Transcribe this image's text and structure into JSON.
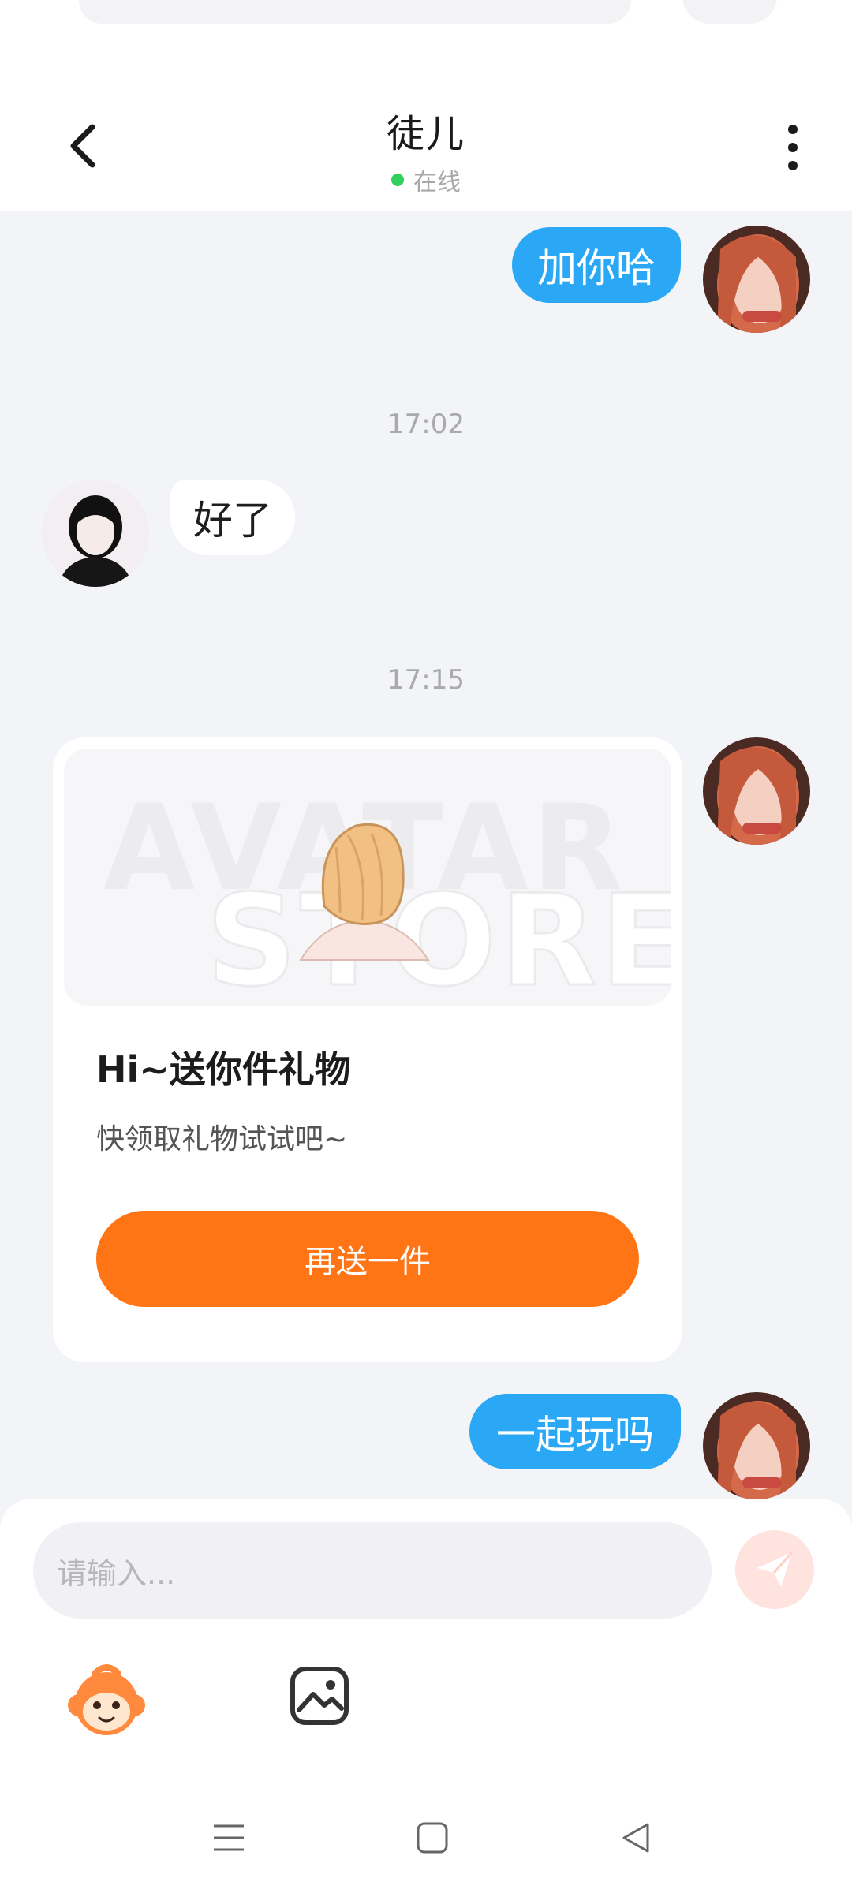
{
  "header": {
    "title": "徒儿",
    "status": "在线",
    "status_color": "#2fd05c"
  },
  "messages": [
    {
      "direction": "out",
      "text": "加你哈"
    },
    {
      "time": "17:02"
    },
    {
      "direction": "in",
      "text": "好了"
    },
    {
      "time": "17:15"
    },
    {
      "direction": "out",
      "type": "gift",
      "banner_watermark": [
        "AVATAR",
        "STORE"
      ],
      "title": "Hi~送你件礼物",
      "subtitle": "快领取礼物试试吧~",
      "button_label": "再送一件"
    },
    {
      "direction": "out",
      "text": "一起玩吗"
    }
  ],
  "input": {
    "placeholder": "请输入..."
  },
  "toolbar": {
    "icons": [
      "emoji-mascot-icon",
      "image-icon"
    ]
  },
  "navbar": {
    "icons": [
      "menu-icon",
      "home-square-icon",
      "back-triangle-icon"
    ]
  },
  "colors": {
    "accent_blue": "#2ba8f5",
    "gift_button": "#ff7414",
    "send_button_bg": "#ffe3df"
  }
}
